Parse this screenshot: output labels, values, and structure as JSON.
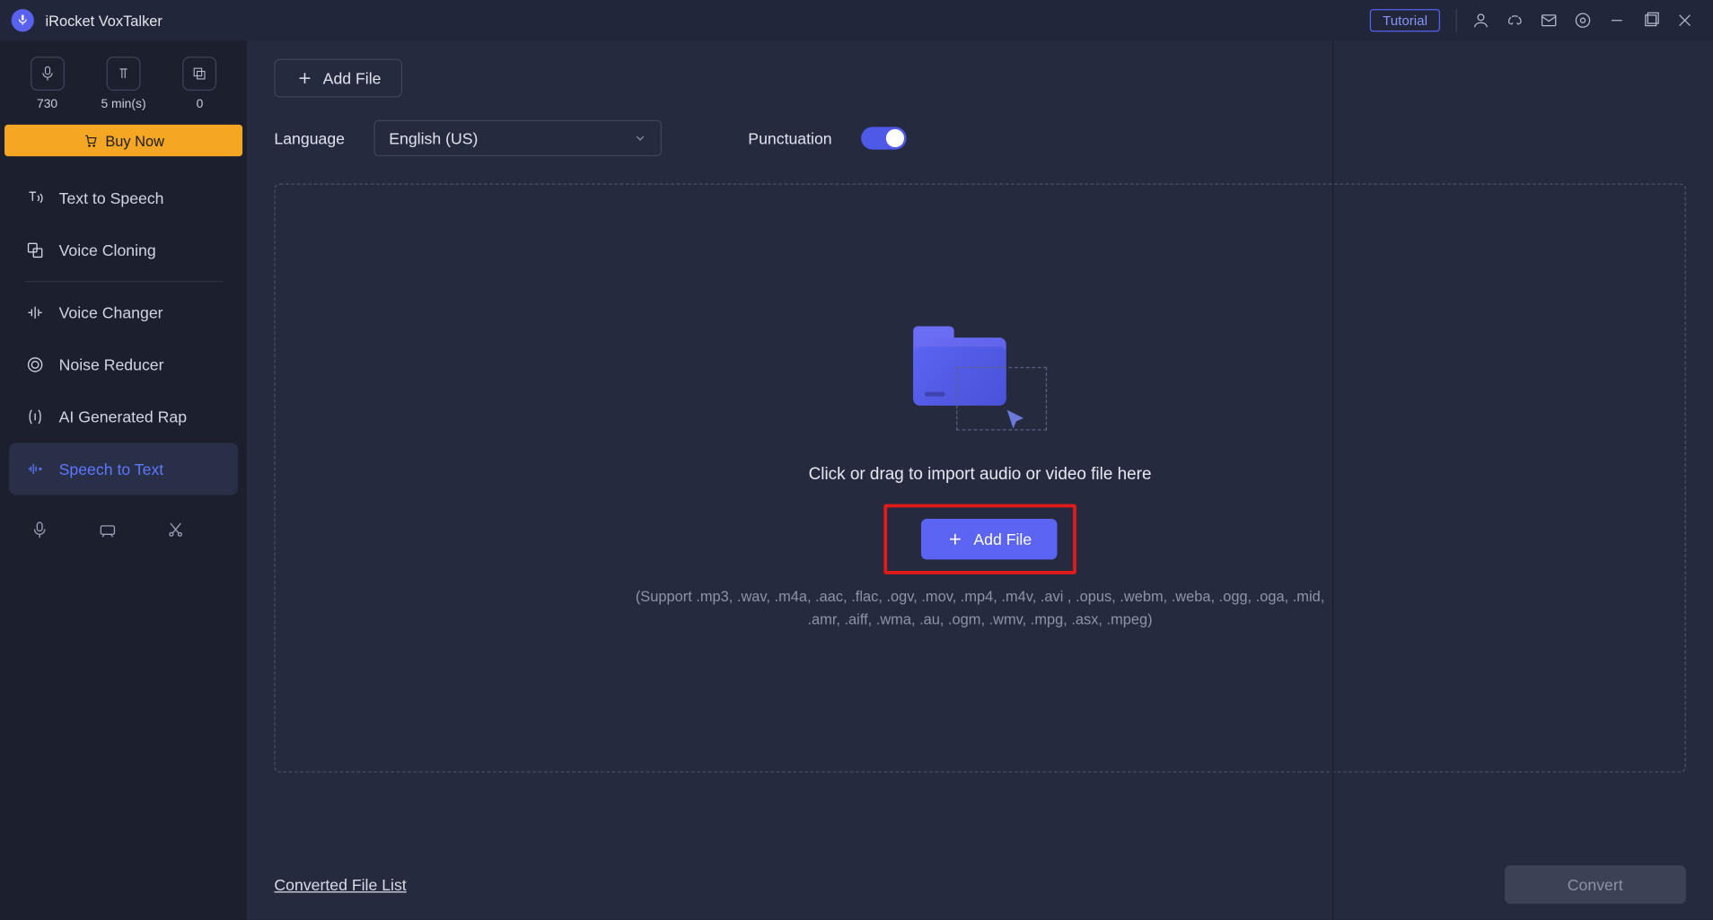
{
  "titlebar": {
    "app_name": "iRocket VoxTalker",
    "tutorial": "Tutorial"
  },
  "sidebar": {
    "credits": [
      {
        "value": "730"
      },
      {
        "value": "5 min(s)"
      },
      {
        "value": "0"
      }
    ],
    "buy_now": "Buy Now",
    "nav": [
      "Text to Speech",
      "Voice Cloning",
      "Voice Changer",
      "Noise Reducer",
      "AI Generated Rap",
      "Speech to Text"
    ]
  },
  "main": {
    "add_file": "Add File",
    "language_label": "Language",
    "language_value": "English (US)",
    "punctuation_label": "Punctuation",
    "dropzone": {
      "hint": "Click or drag to import audio or video file here",
      "add_file": "Add File",
      "support": "(Support .mp3, .wav, .m4a, .aac, .flac, .ogv, .mov, .mp4, .m4v, .avi , .opus, .webm, .weba, .ogg, .oga, .mid, .amr, .aiff, .wma, .au, .ogm, .wmv, .mpg, .asx, .mpeg)"
    },
    "converted_link": "Converted File List",
    "convert_button": "Convert"
  }
}
